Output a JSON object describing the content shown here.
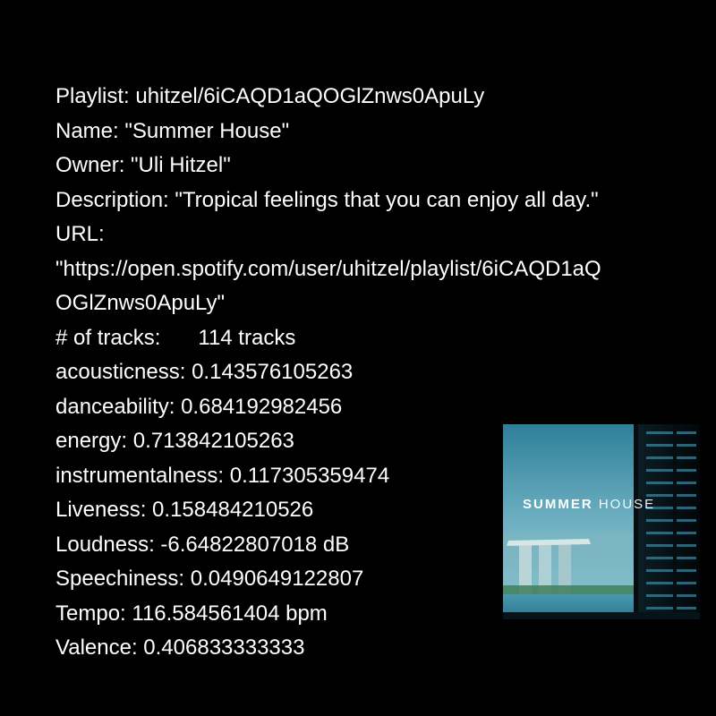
{
  "playlist": {
    "id_line": "Playlist: uhitzel/6iCAQD1aQOGlZnws0ApuLy",
    "name_line": "Name: \"Summer House\"",
    "owner_line": "Owner: \"Uli Hitzel\"",
    "description_line": "Description: \"Tropical feelings that you can enjoy all day.\"",
    "url_label": "URL:",
    "url_line1": "\"https://open.spotify.com/user/uhitzel/playlist/6iCAQD1aQ",
    "url_line2": "OGlZnws0ApuLy\"",
    "tracks_label": "# of tracks:",
    "tracks_value": "114 tracks"
  },
  "features": {
    "acousticness": "acousticness: 0.143576105263",
    "danceability": "danceability: 0.684192982456",
    "energy": "energy: 0.713842105263",
    "instrumentalness": "instrumentalness: 0.117305359474",
    "liveness": "Liveness: 0.158484210526",
    "loudness": "Loudness: -6.64822807018 dB",
    "speechiness": "Speechiness: 0.0490649122807",
    "tempo": "Tempo: 116.584561404 bpm",
    "valence": "Valence: 0.406833333333"
  },
  "cover": {
    "title_bold": "SUMMER",
    "title_light": "HOUSE"
  },
  "colors": {
    "background": "#000000",
    "text": "#ffffff",
    "sky": "#5fa3b8",
    "water": "#3e8ea4"
  }
}
